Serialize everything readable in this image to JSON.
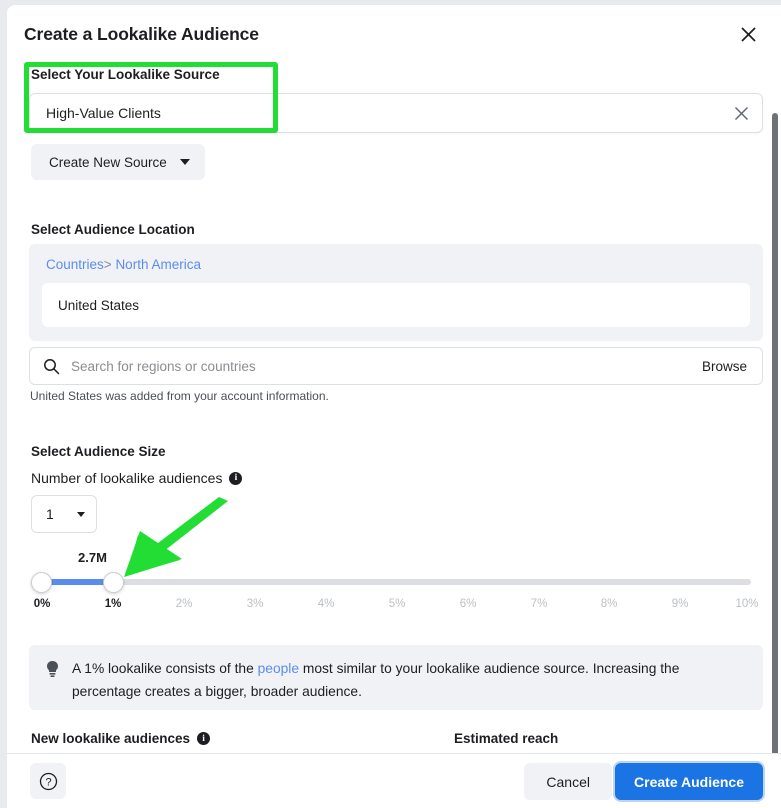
{
  "dialog": {
    "title": "Create a Lookalike Audience",
    "close_icon": "close-icon"
  },
  "source": {
    "label": "Select Your Lookalike Source",
    "value": "High-Value Clients",
    "clear_icon": "close-icon",
    "create_new_label": "Create New Source",
    "create_new_caret": "chevron-down-icon"
  },
  "location": {
    "label": "Select Audience Location",
    "breadcrumb": {
      "root": "Countries",
      "separator": ">",
      "current": "North America"
    },
    "selected": "United States",
    "search_placeholder": "Search for regions or countries",
    "search_value": "",
    "search_icon": "search-icon",
    "browse_label": "Browse",
    "note": "United States was added from your account information."
  },
  "size": {
    "label": "Select Audience Size",
    "number_label": "Number of lookalike audiences",
    "number_info_icon": "info-icon",
    "number_value": "1",
    "number_caret": "chevron-down-icon",
    "reach_bubble": "2.7M",
    "slider": {
      "min_percent": "0%",
      "selected_percent": "1%",
      "ticks": [
        "0%",
        "1%",
        "2%",
        "3%",
        "4%",
        "5%",
        "6%",
        "7%",
        "8%",
        "9%",
        "10%"
      ],
      "active_ticks": [
        "0%",
        "1%"
      ],
      "fill_color": "#5b8def",
      "track_color": "#dcdee1"
    }
  },
  "tip": {
    "icon": "lightbulb-icon",
    "text_before": "A 1% lookalike consists of the ",
    "link": "people",
    "text_after": " most similar to your lookalike audience source. Increasing the percentage creates a bigger, broader audience."
  },
  "columns": {
    "left_header": "New lookalike audiences",
    "left_info_icon": "info-icon",
    "right_header": "Estimated reach"
  },
  "footer": {
    "help_icon": "help-circle-icon",
    "cancel_label": "Cancel",
    "create_label": "Create Audience",
    "primary_color": "#1b74e4"
  },
  "annotations": {
    "highlight_box_color": "#22dd33",
    "arrow_color": "#22dd33",
    "arrow_target": "slider thumb at 1%"
  }
}
